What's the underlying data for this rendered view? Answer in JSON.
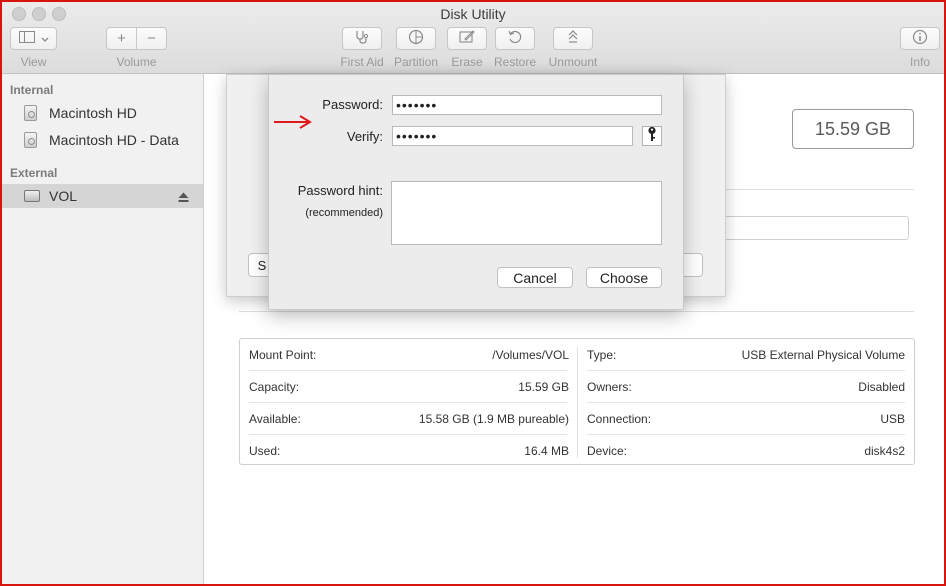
{
  "window": {
    "title": "Disk Utility"
  },
  "toolbar": {
    "view_label": "View",
    "volume_label": "Volume",
    "first_aid_label": "First Aid",
    "partition_label": "Partition",
    "erase_label": "Erase",
    "restore_label": "Restore",
    "unmount_label": "Unmount",
    "info_label": "Info"
  },
  "sidebar": {
    "internal_header": "Internal",
    "external_header": "External",
    "internal_items": [
      {
        "label": "Macintosh HD"
      },
      {
        "label": "Macintosh HD - Data"
      }
    ],
    "external_items": [
      {
        "label": "VOL",
        "selected": true
      }
    ]
  },
  "main": {
    "capacity_display": "15.59 GB",
    "peek_button_text": "S",
    "info": {
      "left": [
        {
          "label": "Mount Point:",
          "value": "/Volumes/VOL"
        },
        {
          "label": "Capacity:",
          "value": "15.59 GB"
        },
        {
          "label": "Available:",
          "value": "15.58 GB (1.9 MB pureable)"
        },
        {
          "label": "Used:",
          "value": "16.4 MB"
        }
      ],
      "right": [
        {
          "label": "Type:",
          "value": "USB External Physical Volume"
        },
        {
          "label": "Owners:",
          "value": "Disabled"
        },
        {
          "label": "Connection:",
          "value": "USB"
        },
        {
          "label": "Device:",
          "value": "disk4s2"
        }
      ]
    }
  },
  "dialog": {
    "password_label": "Password:",
    "password_value": "•••••••",
    "verify_label": "Verify:",
    "verify_value": "•••••••",
    "hint_label": "Password hint:",
    "hint_sublabel": "(recommended)",
    "hint_value": "",
    "cancel_label": "Cancel",
    "choose_label": "Choose"
  },
  "colors": {
    "annotation_arrow": "#e0181b",
    "frame_border": "#d8140f"
  }
}
